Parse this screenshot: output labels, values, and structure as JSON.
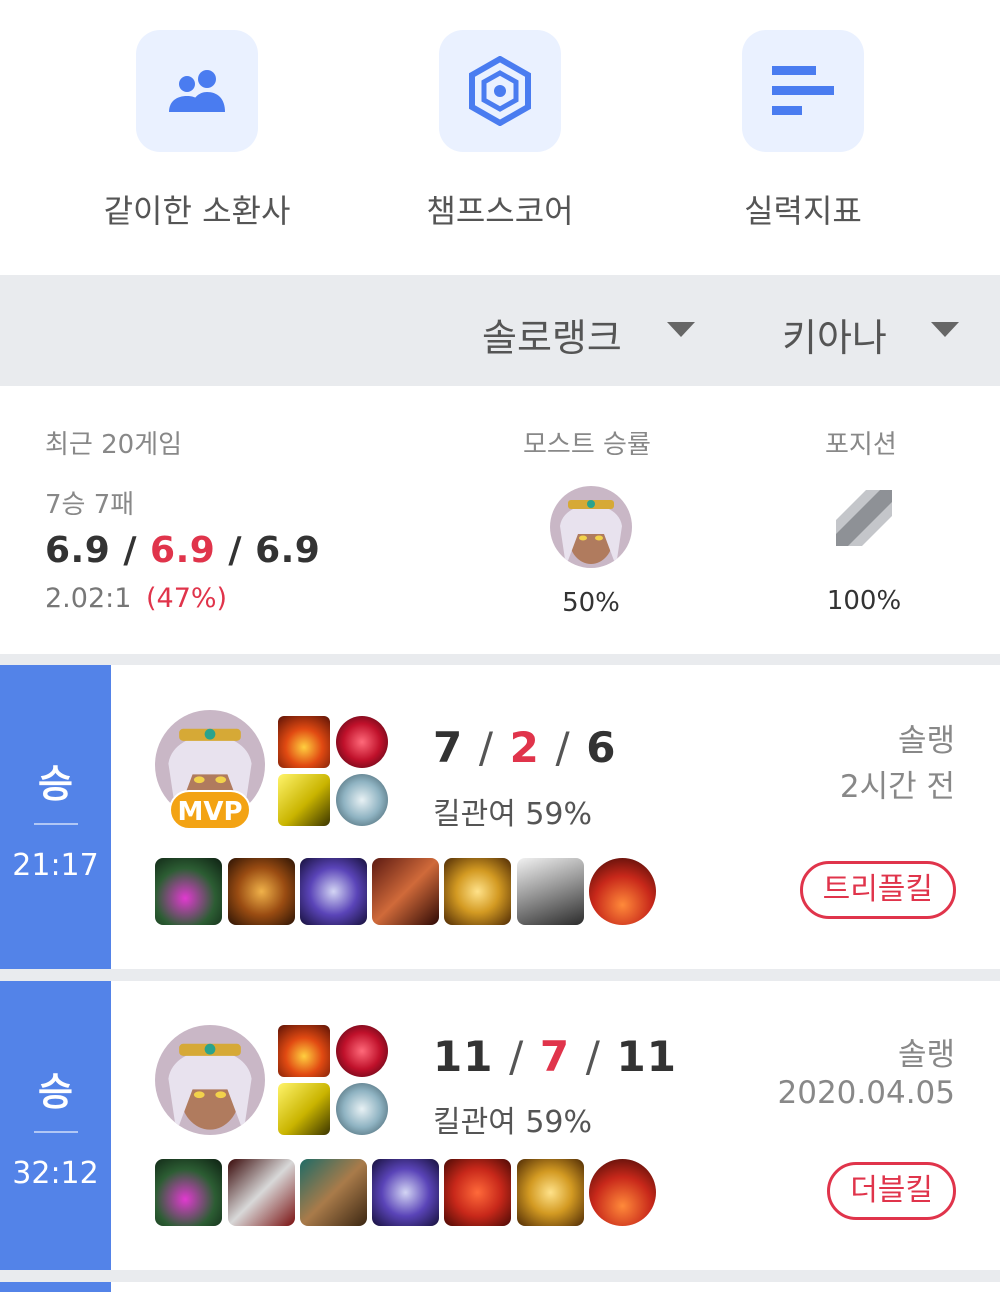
{
  "top_nav": {
    "items": [
      {
        "label": "같이한 소환사",
        "icon": "people-icon"
      },
      {
        "label": "챔프스코어",
        "icon": "hexagon-icon"
      },
      {
        "label": "실력지표",
        "icon": "bars-icon"
      }
    ]
  },
  "filters": {
    "queue": "솔로랭크",
    "champion": "키아나"
  },
  "summary": {
    "recent_label": "최근 20게임",
    "record": "7승 7패",
    "kda_kills": "6.9",
    "kda_deaths": "6.9",
    "kda_assists": "6.9",
    "slash": "/",
    "ratio": "2.02:1",
    "winrate": "(47%)",
    "most_label": "모스트 승률",
    "most_pct": "50%",
    "position_label": "포지션",
    "position_pct": "100%"
  },
  "matches": [
    {
      "result": "승",
      "duration": "21:17",
      "mvp": "MVP",
      "kills": "7",
      "deaths": "2",
      "assists": "6",
      "kill_participation": "킬관여 59%",
      "queue": "솔랭",
      "time_ago": "2시간 전",
      "badge": "트리플킬"
    },
    {
      "result": "승",
      "duration": "32:12",
      "kills": "11",
      "deaths": "7",
      "assists": "11",
      "kill_participation": "킬관여 59%",
      "queue": "솔랭",
      "time_ago": "2020.04.05",
      "badge": "더블킬"
    }
  ],
  "colors": {
    "win": "#5383e8",
    "accent_red": "#e0344b",
    "mvp": "#f3a314",
    "tile_bg": "#eaf1ff",
    "icon_blue": "#4a7cf0"
  }
}
